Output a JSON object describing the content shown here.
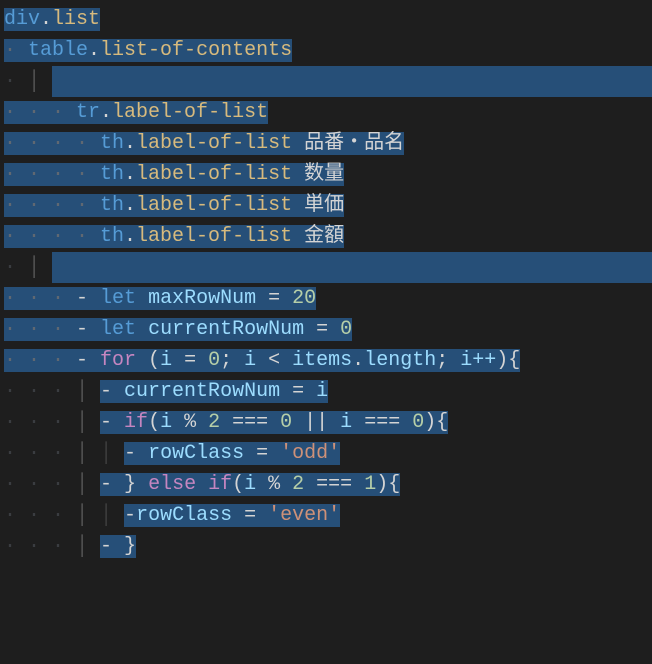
{
  "code": {
    "l1": {
      "tag": "div",
      "cls": "list"
    },
    "l2": {
      "tag": "table",
      "cls": "list-of-contents"
    },
    "l4": {
      "tag": "tr",
      "cls": "label-of-list"
    },
    "l5": {
      "tag": "th",
      "cls": "label-of-list",
      "txt": "品番・品名"
    },
    "l6": {
      "tag": "th",
      "cls": "label-of-list",
      "txt": "数量"
    },
    "l7": {
      "tag": "th",
      "cls": "label-of-list",
      "txt": "単価"
    },
    "l8": {
      "tag": "th",
      "cls": "label-of-list",
      "txt": "金額"
    },
    "l10": {
      "kw": "let",
      "var": "maxRowNum",
      "val": "20"
    },
    "l11": {
      "kw": "let",
      "var": "currentRowNum",
      "val": "0"
    },
    "l12": {
      "kw": "for",
      "i": "i",
      "z": "0",
      "items": "items",
      "len": "length",
      "inc": "i++"
    },
    "l13": {
      "var": "currentRowNum",
      "rhs": "i"
    },
    "l14": {
      "kw": "if",
      "i": "i",
      "mod": "2",
      "z0": "0",
      "z1": "0"
    },
    "l15": {
      "var": "rowClass",
      "str": "'odd'"
    },
    "l16": {
      "else": "else",
      "kw": "if",
      "i": "i",
      "mod": "2",
      "one": "1"
    },
    "l17": {
      "var": "rowClass",
      "str": "'even'"
    },
    "l18": {
      "brace": "}"
    }
  }
}
